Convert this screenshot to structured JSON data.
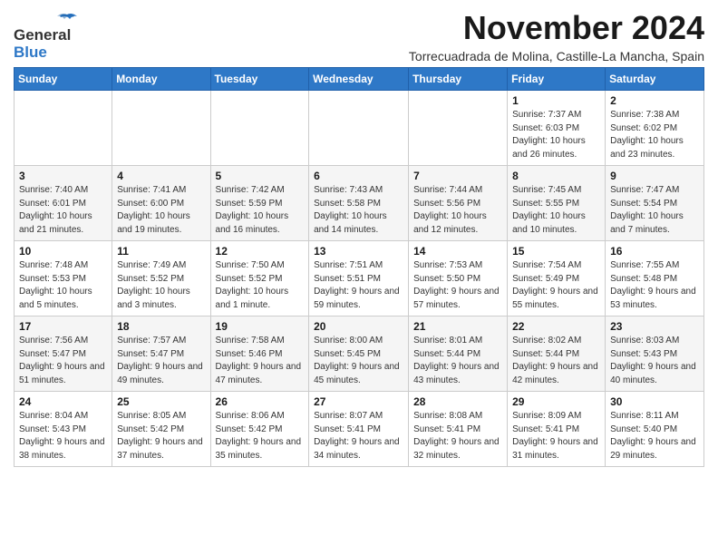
{
  "header": {
    "logo_general": "General",
    "logo_blue": "Blue",
    "month_title": "November 2024",
    "location": "Torrecuadrada de Molina, Castille-La Mancha, Spain"
  },
  "weekdays": [
    "Sunday",
    "Monday",
    "Tuesday",
    "Wednesday",
    "Thursday",
    "Friday",
    "Saturday"
  ],
  "weeks": [
    [
      {
        "day": "",
        "info": ""
      },
      {
        "day": "",
        "info": ""
      },
      {
        "day": "",
        "info": ""
      },
      {
        "day": "",
        "info": ""
      },
      {
        "day": "",
        "info": ""
      },
      {
        "day": "1",
        "info": "Sunrise: 7:37 AM\nSunset: 6:03 PM\nDaylight: 10 hours and 26 minutes."
      },
      {
        "day": "2",
        "info": "Sunrise: 7:38 AM\nSunset: 6:02 PM\nDaylight: 10 hours and 23 minutes."
      }
    ],
    [
      {
        "day": "3",
        "info": "Sunrise: 7:40 AM\nSunset: 6:01 PM\nDaylight: 10 hours and 21 minutes."
      },
      {
        "day": "4",
        "info": "Sunrise: 7:41 AM\nSunset: 6:00 PM\nDaylight: 10 hours and 19 minutes."
      },
      {
        "day": "5",
        "info": "Sunrise: 7:42 AM\nSunset: 5:59 PM\nDaylight: 10 hours and 16 minutes."
      },
      {
        "day": "6",
        "info": "Sunrise: 7:43 AM\nSunset: 5:58 PM\nDaylight: 10 hours and 14 minutes."
      },
      {
        "day": "7",
        "info": "Sunrise: 7:44 AM\nSunset: 5:56 PM\nDaylight: 10 hours and 12 minutes."
      },
      {
        "day": "8",
        "info": "Sunrise: 7:45 AM\nSunset: 5:55 PM\nDaylight: 10 hours and 10 minutes."
      },
      {
        "day": "9",
        "info": "Sunrise: 7:47 AM\nSunset: 5:54 PM\nDaylight: 10 hours and 7 minutes."
      }
    ],
    [
      {
        "day": "10",
        "info": "Sunrise: 7:48 AM\nSunset: 5:53 PM\nDaylight: 10 hours and 5 minutes."
      },
      {
        "day": "11",
        "info": "Sunrise: 7:49 AM\nSunset: 5:52 PM\nDaylight: 10 hours and 3 minutes."
      },
      {
        "day": "12",
        "info": "Sunrise: 7:50 AM\nSunset: 5:52 PM\nDaylight: 10 hours and 1 minute."
      },
      {
        "day": "13",
        "info": "Sunrise: 7:51 AM\nSunset: 5:51 PM\nDaylight: 9 hours and 59 minutes."
      },
      {
        "day": "14",
        "info": "Sunrise: 7:53 AM\nSunset: 5:50 PM\nDaylight: 9 hours and 57 minutes."
      },
      {
        "day": "15",
        "info": "Sunrise: 7:54 AM\nSunset: 5:49 PM\nDaylight: 9 hours and 55 minutes."
      },
      {
        "day": "16",
        "info": "Sunrise: 7:55 AM\nSunset: 5:48 PM\nDaylight: 9 hours and 53 minutes."
      }
    ],
    [
      {
        "day": "17",
        "info": "Sunrise: 7:56 AM\nSunset: 5:47 PM\nDaylight: 9 hours and 51 minutes."
      },
      {
        "day": "18",
        "info": "Sunrise: 7:57 AM\nSunset: 5:47 PM\nDaylight: 9 hours and 49 minutes."
      },
      {
        "day": "19",
        "info": "Sunrise: 7:58 AM\nSunset: 5:46 PM\nDaylight: 9 hours and 47 minutes."
      },
      {
        "day": "20",
        "info": "Sunrise: 8:00 AM\nSunset: 5:45 PM\nDaylight: 9 hours and 45 minutes."
      },
      {
        "day": "21",
        "info": "Sunrise: 8:01 AM\nSunset: 5:44 PM\nDaylight: 9 hours and 43 minutes."
      },
      {
        "day": "22",
        "info": "Sunrise: 8:02 AM\nSunset: 5:44 PM\nDaylight: 9 hours and 42 minutes."
      },
      {
        "day": "23",
        "info": "Sunrise: 8:03 AM\nSunset: 5:43 PM\nDaylight: 9 hours and 40 minutes."
      }
    ],
    [
      {
        "day": "24",
        "info": "Sunrise: 8:04 AM\nSunset: 5:43 PM\nDaylight: 9 hours and 38 minutes."
      },
      {
        "day": "25",
        "info": "Sunrise: 8:05 AM\nSunset: 5:42 PM\nDaylight: 9 hours and 37 minutes."
      },
      {
        "day": "26",
        "info": "Sunrise: 8:06 AM\nSunset: 5:42 PM\nDaylight: 9 hours and 35 minutes."
      },
      {
        "day": "27",
        "info": "Sunrise: 8:07 AM\nSunset: 5:41 PM\nDaylight: 9 hours and 34 minutes."
      },
      {
        "day": "28",
        "info": "Sunrise: 8:08 AM\nSunset: 5:41 PM\nDaylight: 9 hours and 32 minutes."
      },
      {
        "day": "29",
        "info": "Sunrise: 8:09 AM\nSunset: 5:41 PM\nDaylight: 9 hours and 31 minutes."
      },
      {
        "day": "30",
        "info": "Sunrise: 8:11 AM\nSunset: 5:40 PM\nDaylight: 9 hours and 29 minutes."
      }
    ]
  ]
}
